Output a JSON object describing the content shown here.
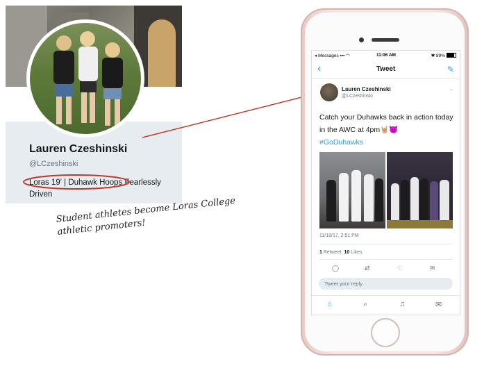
{
  "profile": {
    "name": "Lauren Czeshinski",
    "handle": "@LCzeshinski",
    "bio": "Loras 19' | Duhawk Hoops  Fearlessly Driven"
  },
  "caption": {
    "line1": "Student athletes become Loras College",
    "line2": "athletic promoters!"
  },
  "status_bar": {
    "carrier": "Messages",
    "time": "11:06 AM",
    "battery": "89%"
  },
  "tweet_view": {
    "title": "Tweet",
    "author_name": "Lauren Czeshinski",
    "author_handle": "@LCzeshinski",
    "text": "Catch your Duhawks back in action today in the AWC at 4pm",
    "emoji": "🤘🏼😈",
    "hashtag": "#GoDuhawks",
    "timestamp": "11/18/17, 2:51 PM",
    "retweets_count": "1",
    "retweets_label": "Retweet",
    "likes_count": "10",
    "likes_label": "Likes",
    "reply_placeholder": "Tweet your reply"
  },
  "colors": {
    "accent": "#1da1f2",
    "annotation": "#c0392b",
    "phone_body": "#f6e4e1"
  },
  "icons": [
    "back-icon",
    "compose-icon",
    "reply-icon",
    "retweet-icon",
    "like-icon",
    "message-icon",
    "home-icon",
    "search-icon",
    "notifications-icon",
    "dm-icon"
  ]
}
